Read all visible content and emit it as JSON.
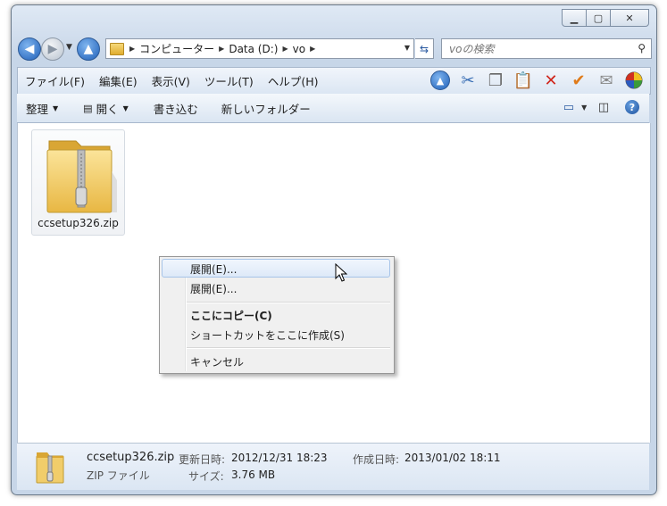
{
  "window": {
    "caption": {
      "minimize_icon": "minimize-icon",
      "maximize_icon": "maximize-icon",
      "close_icon": "close-icon"
    }
  },
  "nav": {
    "breadcrumbs": [
      "コンピューター",
      "Data (D:)",
      "vo"
    ],
    "search_placeholder": "voの検索"
  },
  "menubar": {
    "items": [
      "ファイル(F)",
      "編集(E)",
      "表示(V)",
      "ツール(T)",
      "ヘルプ(H)"
    ],
    "toolbar_icons": [
      "up-icon",
      "cut-icon",
      "copy-icon",
      "paste-icon",
      "delete-icon",
      "check-icon",
      "mail-icon",
      "palette-icon"
    ]
  },
  "commandbar": {
    "organize": "整理",
    "open": "開く",
    "burn": "書き込む",
    "new_folder": "新しいフォルダー"
  },
  "files": [
    {
      "name": "ccsetup326.zip",
      "icon": "zip-folder-icon"
    }
  ],
  "context_menu": {
    "items": [
      {
        "label": "展開(E)...",
        "highlighted": true
      },
      {
        "label": "展開(E)..."
      },
      {
        "label": "ここにコピー(C)",
        "bold": true
      },
      {
        "label": "ショートカットをここに作成(S)"
      },
      {
        "label": "キャンセル"
      }
    ]
  },
  "details": {
    "name": "ccsetup326.zip",
    "type": "ZIP ファイル",
    "modified_label": "更新日時:",
    "modified_value": "2012/12/31 18:23",
    "created_label": "作成日時:",
    "created_value": "2013/01/02 18:11",
    "size_label": "サイズ:",
    "size_value": "3.76 MB"
  }
}
